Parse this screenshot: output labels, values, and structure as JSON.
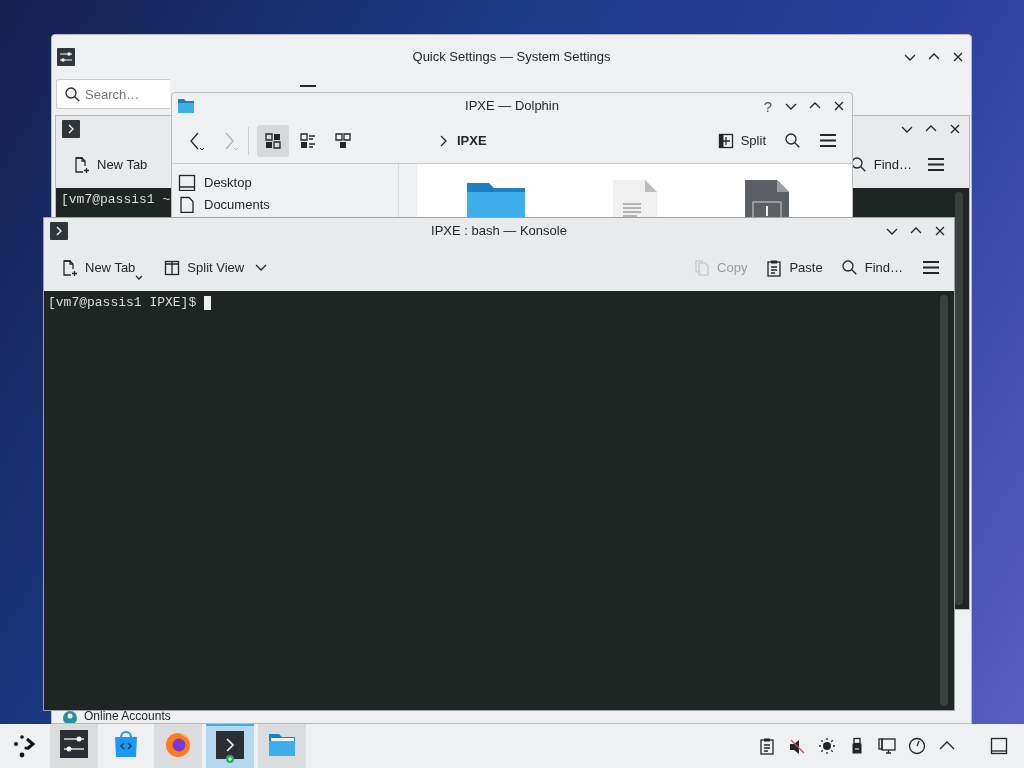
{
  "system_settings": {
    "title": "Quick Settings — System Settings",
    "search": {
      "placeholder": "Search…"
    },
    "sidebar_items": [
      {
        "label": "Online Accounts"
      }
    ]
  },
  "konsole_background": {
    "toolbar": [
      {
        "kind": "new_tab",
        "label": "New Tab"
      }
    ],
    "find": {
      "label": "Find…"
    },
    "terminal_lines": [
      "[vm7@passis1 ~"
    ]
  },
  "dolphin": {
    "title": "IPXE — Dolphin",
    "help": "?",
    "view_modes": [
      {
        "kind": "icons",
        "selected": true
      },
      {
        "kind": "compact",
        "selected": false
      },
      {
        "kind": "details",
        "selected": false
      }
    ],
    "breadcrumb": [
      "IPXE"
    ],
    "split": {
      "label": "Split"
    },
    "places": [
      {
        "kind": "desktop",
        "label": "Desktop"
      },
      {
        "kind": "documents",
        "label": "Documents"
      }
    ],
    "files": [
      {
        "kind": "folder"
      },
      {
        "kind": "text"
      },
      {
        "kind": "binary"
      }
    ]
  },
  "konsole": {
    "title": "IPXE : bash — Konsole",
    "toolbar_left": [
      {
        "kind": "new_tab",
        "label": "New Tab"
      },
      {
        "kind": "split_view",
        "label": "Split View"
      }
    ],
    "toolbar_right": [
      {
        "kind": "copy",
        "label": "Copy",
        "disabled": true
      },
      {
        "kind": "paste",
        "label": "Paste",
        "disabled": false
      },
      {
        "kind": "find",
        "label": "Find…",
        "disabled": false
      }
    ],
    "prompt": "[vm7@passis1 IPXE]$"
  },
  "taskbar": {
    "tasks": [
      {
        "kind": "settings",
        "open": true,
        "selected": false
      },
      {
        "kind": "store",
        "open": false,
        "selected": false
      },
      {
        "kind": "browser",
        "open": true,
        "selected": false
      },
      {
        "kind": "terminal",
        "open": true,
        "selected": true
      },
      {
        "kind": "files",
        "open": true,
        "selected": false
      }
    ]
  }
}
